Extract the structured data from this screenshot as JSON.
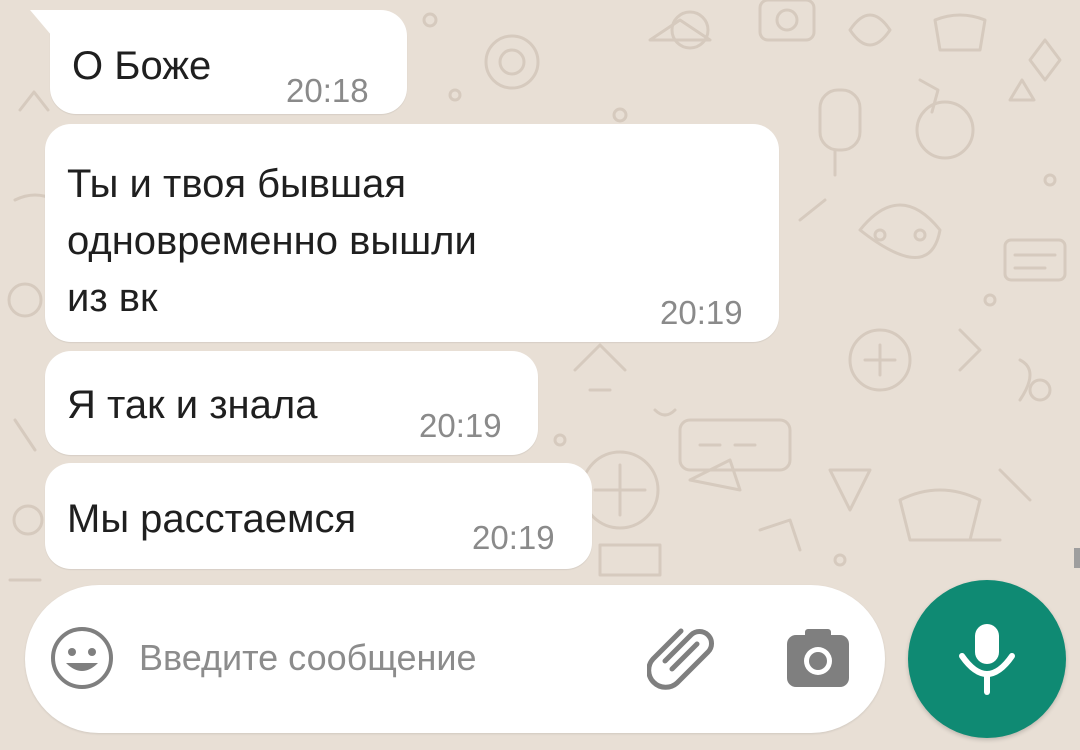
{
  "colors": {
    "wallpaper": "#e8dfd5",
    "bubble": "#ffffff",
    "accent": "#0f8a73",
    "time_text": "#8a8a8a",
    "placeholder_text": "#8c8c8c"
  },
  "messages": [
    {
      "text": "О Боже",
      "time": "20:18"
    },
    {
      "text": "Ты и твоя бывшая\nодновременно вышли\nиз вк",
      "time": "20:19"
    },
    {
      "text": "Я так и знала",
      "time": "20:19"
    },
    {
      "text": "Мы расстаемся",
      "time": "20:19"
    }
  ],
  "composer": {
    "placeholder": "Введите сообщение",
    "value": "",
    "emoji_icon": "smiley-icon",
    "attach_icon": "paperclip-icon",
    "camera_icon": "camera-icon",
    "send_icon": "microphone-icon"
  }
}
